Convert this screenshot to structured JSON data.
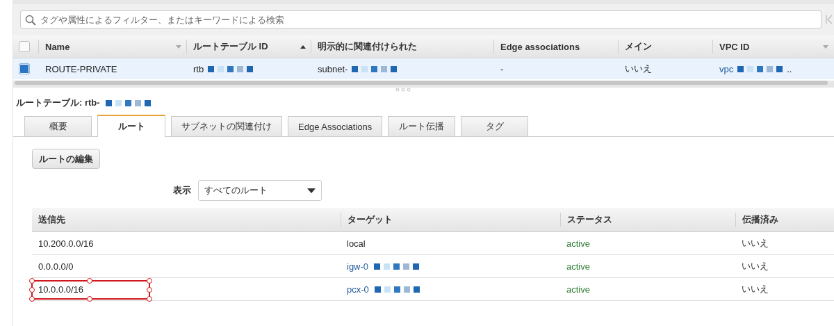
{
  "search": {
    "placeholder": "タグや属性によるフィルター、またはキーワードによる検索"
  },
  "table": {
    "select_all": {
      "checked": false
    },
    "columns": [
      {
        "label": "Name",
        "kind": "descending"
      },
      {
        "label": "ルートテーブル ID",
        "kind": "ascending"
      },
      {
        "label": "明示的に関連付けられた",
        "kind": "unsorted"
      },
      {
        "label": "Edge associations",
        "kind": "unsorted"
      },
      {
        "label": "メイン",
        "kind": "unsorted"
      },
      {
        "label": "VPC ID",
        "kind": "descending"
      }
    ],
    "rows": [
      {
        "selected": true,
        "cells": [
          {
            "text": "ROUTE-PRIVATE",
            "kind": "plain",
            "redacted": false
          },
          {
            "text": "rtb",
            "kind": "plain",
            "redacted": true
          },
          {
            "text": "subnet-",
            "kind": "plain",
            "redacted": true
          },
          {
            "text": "-",
            "kind": "plain",
            "redacted": false
          },
          {
            "text": "いいえ",
            "kind": "plain",
            "redacted": false
          },
          {
            "text": "vpc",
            "kind": "link",
            "redacted": true,
            "suffix": ".."
          }
        ]
      }
    ]
  },
  "detail": {
    "title": "ルートテーブル: rtb-",
    "title_redacted": true,
    "tabs": [
      {
        "label": "概要",
        "selected": false
      },
      {
        "label": "ルート",
        "selected": true
      },
      {
        "label": "サブネットの関連付け",
        "selected": false
      },
      {
        "label": "Edge Associations",
        "selected": false
      },
      {
        "label": "ルート伝播",
        "selected": false
      },
      {
        "label": "タグ",
        "selected": false
      }
    ],
    "edit_button": "ルートの編集",
    "filter": {
      "label": "表示",
      "value": "すべてのルート"
    },
    "routes": {
      "columns": [
        "送信先",
        "ターゲット",
        "ステータス",
        "伝播済み"
      ],
      "rows": [
        {
          "destination": "10.200.0.0/16",
          "target": {
            "text": "local",
            "kind": "plain",
            "redacted": false
          },
          "status": "active",
          "propagated": "いいえ",
          "highlighted": false
        },
        {
          "destination": "0.0.0.0/0",
          "target": {
            "text": "igw-0",
            "kind": "link",
            "redacted": true
          },
          "status": "active",
          "propagated": "いいえ",
          "highlighted": false
        },
        {
          "destination": "10.0.0.0/16",
          "target": {
            "text": "pcx-0",
            "kind": "link",
            "redacted": true
          },
          "status": "active",
          "propagated": "いいえ",
          "highlighted": true
        }
      ]
    }
  }
}
